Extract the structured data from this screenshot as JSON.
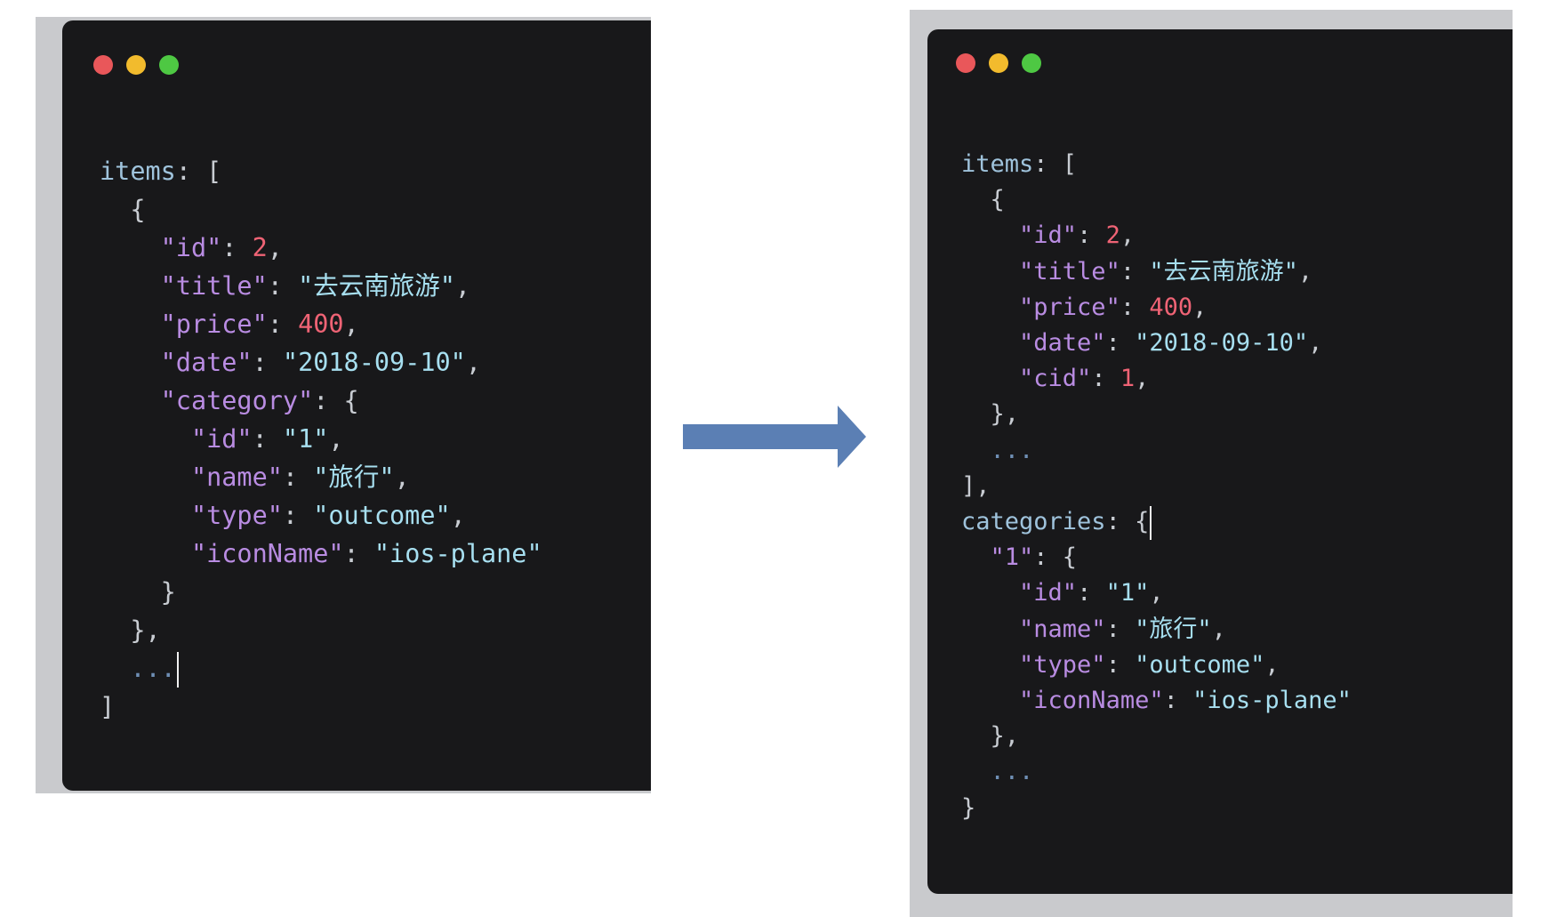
{
  "colors": {
    "window_bg": "#18181a",
    "identifier": "#9fc3dc",
    "key": "#b98ce2",
    "string": "#a7dff0",
    "number": "#ef6375",
    "punctuation": "#c8ccd2",
    "arrow": "#5b7fb4"
  },
  "arrow_icon": "right-arrow",
  "left": {
    "lines": [
      [
        [
          "ident",
          "items"
        ],
        [
          "punc",
          ": ["
        ]
      ],
      [
        [
          "punc",
          "  {"
        ]
      ],
      [
        [
          "punc",
          "    "
        ],
        [
          "key",
          "\"id\""
        ],
        [
          "punc",
          ": "
        ],
        [
          "num",
          "2"
        ],
        [
          "punc",
          ","
        ]
      ],
      [
        [
          "punc",
          "    "
        ],
        [
          "key",
          "\"title\""
        ],
        [
          "punc",
          ": "
        ],
        [
          "str",
          "\"去云南旅游\""
        ],
        [
          "punc",
          ","
        ]
      ],
      [
        [
          "punc",
          "    "
        ],
        [
          "key",
          "\"price\""
        ],
        [
          "punc",
          ": "
        ],
        [
          "num",
          "400"
        ],
        [
          "punc",
          ","
        ]
      ],
      [
        [
          "punc",
          "    "
        ],
        [
          "key",
          "\"date\""
        ],
        [
          "punc",
          ": "
        ],
        [
          "str",
          "\"2018-09-10\""
        ],
        [
          "punc",
          ","
        ]
      ],
      [
        [
          "punc",
          "    "
        ],
        [
          "key",
          "\"category\""
        ],
        [
          "punc",
          ": {"
        ]
      ],
      [
        [
          "punc",
          "      "
        ],
        [
          "key",
          "\"id\""
        ],
        [
          "punc",
          ": "
        ],
        [
          "str",
          "\"1\""
        ],
        [
          "punc",
          ","
        ]
      ],
      [
        [
          "punc",
          "      "
        ],
        [
          "key",
          "\"name\""
        ],
        [
          "punc",
          ": "
        ],
        [
          "str",
          "\"旅行\""
        ],
        [
          "punc",
          ","
        ]
      ],
      [
        [
          "punc",
          "      "
        ],
        [
          "key",
          "\"type\""
        ],
        [
          "punc",
          ": "
        ],
        [
          "str",
          "\"outcome\""
        ],
        [
          "punc",
          ","
        ]
      ],
      [
        [
          "punc",
          "      "
        ],
        [
          "key",
          "\"iconName\""
        ],
        [
          "punc",
          ": "
        ],
        [
          "str",
          "\"ios-plane\""
        ]
      ],
      [
        [
          "punc",
          "    }"
        ]
      ],
      [
        [
          "punc",
          "  },"
        ]
      ],
      [
        [
          "punc",
          "  "
        ],
        [
          "ell",
          "..."
        ],
        [
          "cursor",
          ""
        ]
      ],
      [
        [
          "punc",
          "]"
        ]
      ]
    ]
  },
  "right": {
    "lines": [
      [
        [
          "ident",
          "items"
        ],
        [
          "punc",
          ": ["
        ]
      ],
      [
        [
          "punc",
          "  {"
        ]
      ],
      [
        [
          "punc",
          "    "
        ],
        [
          "key",
          "\"id\""
        ],
        [
          "punc",
          ": "
        ],
        [
          "num",
          "2"
        ],
        [
          "punc",
          ","
        ]
      ],
      [
        [
          "punc",
          "    "
        ],
        [
          "key",
          "\"title\""
        ],
        [
          "punc",
          ": "
        ],
        [
          "str",
          "\"去云南旅游\""
        ],
        [
          "punc",
          ","
        ]
      ],
      [
        [
          "punc",
          "    "
        ],
        [
          "key",
          "\"price\""
        ],
        [
          "punc",
          ": "
        ],
        [
          "num",
          "400"
        ],
        [
          "punc",
          ","
        ]
      ],
      [
        [
          "punc",
          "    "
        ],
        [
          "key",
          "\"date\""
        ],
        [
          "punc",
          ": "
        ],
        [
          "str",
          "\"2018-09-10\""
        ],
        [
          "punc",
          ","
        ]
      ],
      [
        [
          "punc",
          "    "
        ],
        [
          "key",
          "\"cid\""
        ],
        [
          "punc",
          ": "
        ],
        [
          "num",
          "1"
        ],
        [
          "punc",
          ","
        ]
      ],
      [
        [
          "punc",
          "  },"
        ]
      ],
      [
        [
          "punc",
          "  "
        ],
        [
          "ell",
          "..."
        ]
      ],
      [
        [
          "punc",
          "],"
        ]
      ],
      [
        [
          "ident",
          "categories"
        ],
        [
          "punc",
          ": {"
        ],
        [
          "cursor",
          ""
        ]
      ],
      [
        [
          "punc",
          "  "
        ],
        [
          "key",
          "\"1\""
        ],
        [
          "punc",
          ": {"
        ]
      ],
      [
        [
          "punc",
          "    "
        ],
        [
          "key",
          "\"id\""
        ],
        [
          "punc",
          ": "
        ],
        [
          "str",
          "\"1\""
        ],
        [
          "punc",
          ","
        ]
      ],
      [
        [
          "punc",
          "    "
        ],
        [
          "key",
          "\"name\""
        ],
        [
          "punc",
          ": "
        ],
        [
          "str",
          "\"旅行\""
        ],
        [
          "punc",
          ","
        ]
      ],
      [
        [
          "punc",
          "    "
        ],
        [
          "key",
          "\"type\""
        ],
        [
          "punc",
          ": "
        ],
        [
          "str",
          "\"outcome\""
        ],
        [
          "punc",
          ","
        ]
      ],
      [
        [
          "punc",
          "    "
        ],
        [
          "key",
          "\"iconName\""
        ],
        [
          "punc",
          ": "
        ],
        [
          "str",
          "\"ios-plane\""
        ]
      ],
      [
        [
          "punc",
          "  },"
        ]
      ],
      [
        [
          "punc",
          "  "
        ],
        [
          "ell",
          "..."
        ]
      ],
      [
        [
          "punc",
          "}"
        ]
      ]
    ]
  }
}
